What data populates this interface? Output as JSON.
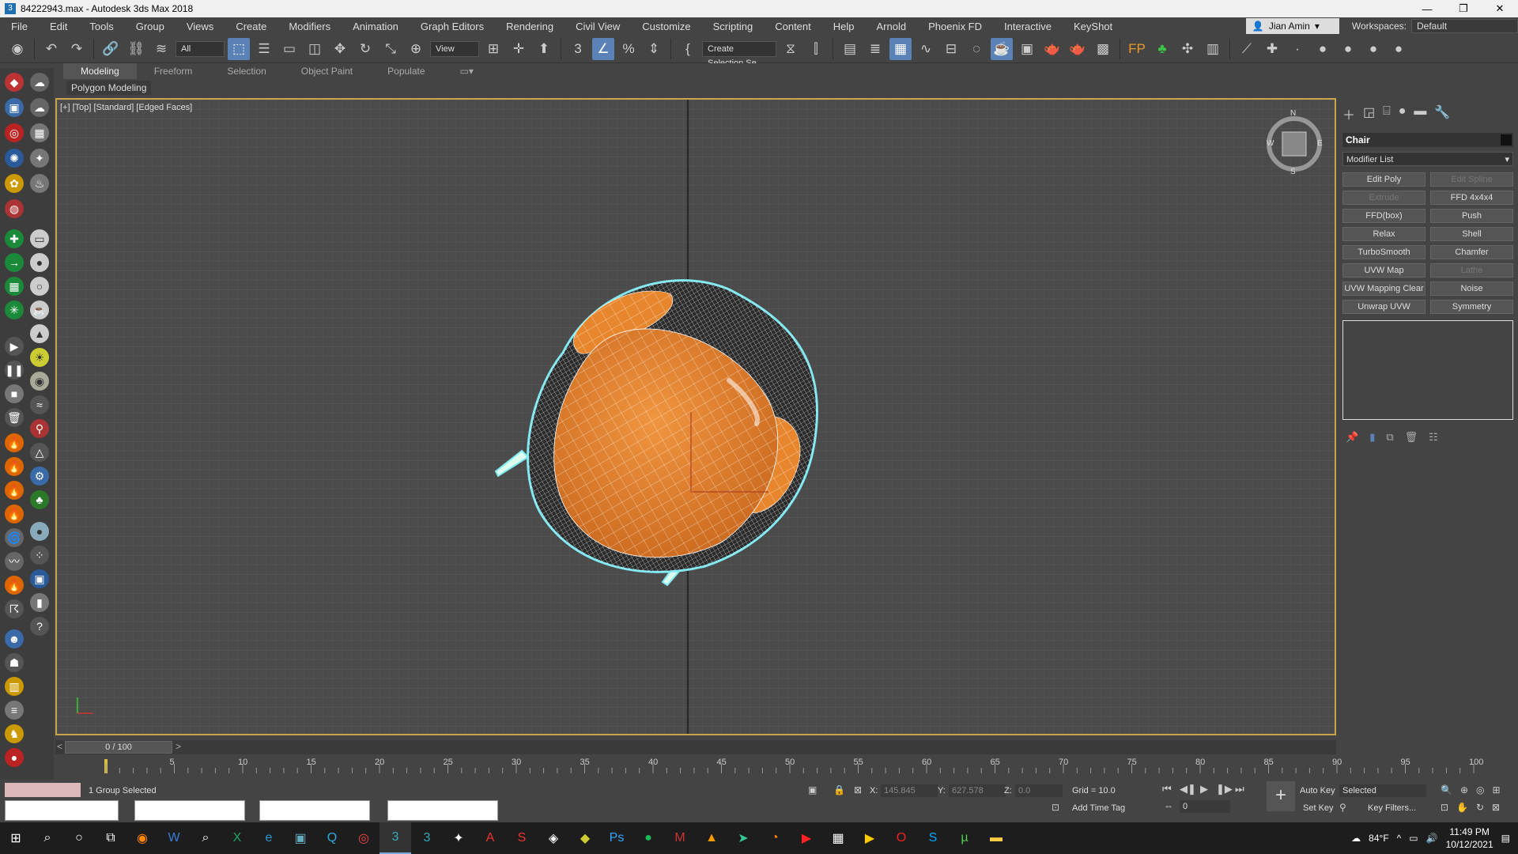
{
  "window": {
    "title": "84222943.max - Autodesk 3ds Max 2018",
    "app_icon": "3ds-max-icon",
    "controls": [
      "minimize-icon",
      "restore-icon",
      "close-icon"
    ]
  },
  "menubar": {
    "items": [
      "File",
      "Edit",
      "Tools",
      "Group",
      "Views",
      "Create",
      "Modifiers",
      "Animation",
      "Graph Editors",
      "Rendering",
      "Civil View",
      "Customize",
      "Scripting",
      "Content",
      "Help",
      "Arnold",
      "Phoenix FD",
      "Interactive",
      "KeyShot"
    ],
    "user": "Jian Amin",
    "workspace_label": "Workspaces:",
    "workspace_value": "Default"
  },
  "toolbar": {
    "selection_filter": "All",
    "reference_coord": "View",
    "named_selection": "Create Selection Se"
  },
  "ribbon": {
    "tabs": [
      "Modeling",
      "Freeform",
      "Selection",
      "Object Paint",
      "Populate"
    ],
    "active_tab": "Modeling",
    "subpanel": "Polygon Modeling"
  },
  "viewport": {
    "label": "[+] [Top] [Standard] [Edged Faces]",
    "compass": {
      "n": "N",
      "s": "S",
      "e": "E",
      "w": "W"
    },
    "object_color": "#e8862e",
    "wire_color": "#ffffff",
    "selection_outline": "#7fe8f0"
  },
  "command_panel": {
    "object_name": "Chair",
    "modifier_list": "Modifier List",
    "modifier_buttons": [
      {
        "label": "Edit Poly",
        "enabled": true
      },
      {
        "label": "Edit Spline",
        "enabled": false
      },
      {
        "label": "Extrude",
        "enabled": false
      },
      {
        "label": "FFD 4x4x4",
        "enabled": true
      },
      {
        "label": "FFD(box)",
        "enabled": true
      },
      {
        "label": "Push",
        "enabled": true
      },
      {
        "label": "Relax",
        "enabled": true
      },
      {
        "label": "Shell",
        "enabled": true
      },
      {
        "label": "TurboSmooth",
        "enabled": true
      },
      {
        "label": "Chamfer",
        "enabled": true
      },
      {
        "label": "UVW Map",
        "enabled": true
      },
      {
        "label": "Lathe",
        "enabled": false
      },
      {
        "label": "UVW Mapping Clear",
        "enabled": true
      },
      {
        "label": "Noise",
        "enabled": true
      },
      {
        "label": "Unwrap UVW",
        "enabled": true
      },
      {
        "label": "Symmetry",
        "enabled": true
      }
    ]
  },
  "timeline": {
    "slider": "0 / 100",
    "ticks": [
      "5",
      "10",
      "15",
      "20",
      "25",
      "30",
      "35",
      "40",
      "45",
      "50",
      "55",
      "60",
      "65",
      "70",
      "75",
      "80",
      "85",
      "90",
      "95",
      "100"
    ]
  },
  "status": {
    "selection_text": "1 Group Selected",
    "x_label": "X:",
    "x_value": "145.845",
    "y_label": "Y:",
    "y_value": "627.578",
    "z_label": "Z:",
    "z_value": "0.0",
    "grid": "Grid = 10.0",
    "add_time_tag": "Add Time Tag",
    "auto_key": "Auto Key",
    "set_key": "Set Key",
    "key_mode": "Selected",
    "key_filters": "Key Filters...",
    "frame": "0"
  },
  "taskbar": {
    "weather": "84°F",
    "time": "11:49 PM",
    "date": "10/12/2021"
  }
}
